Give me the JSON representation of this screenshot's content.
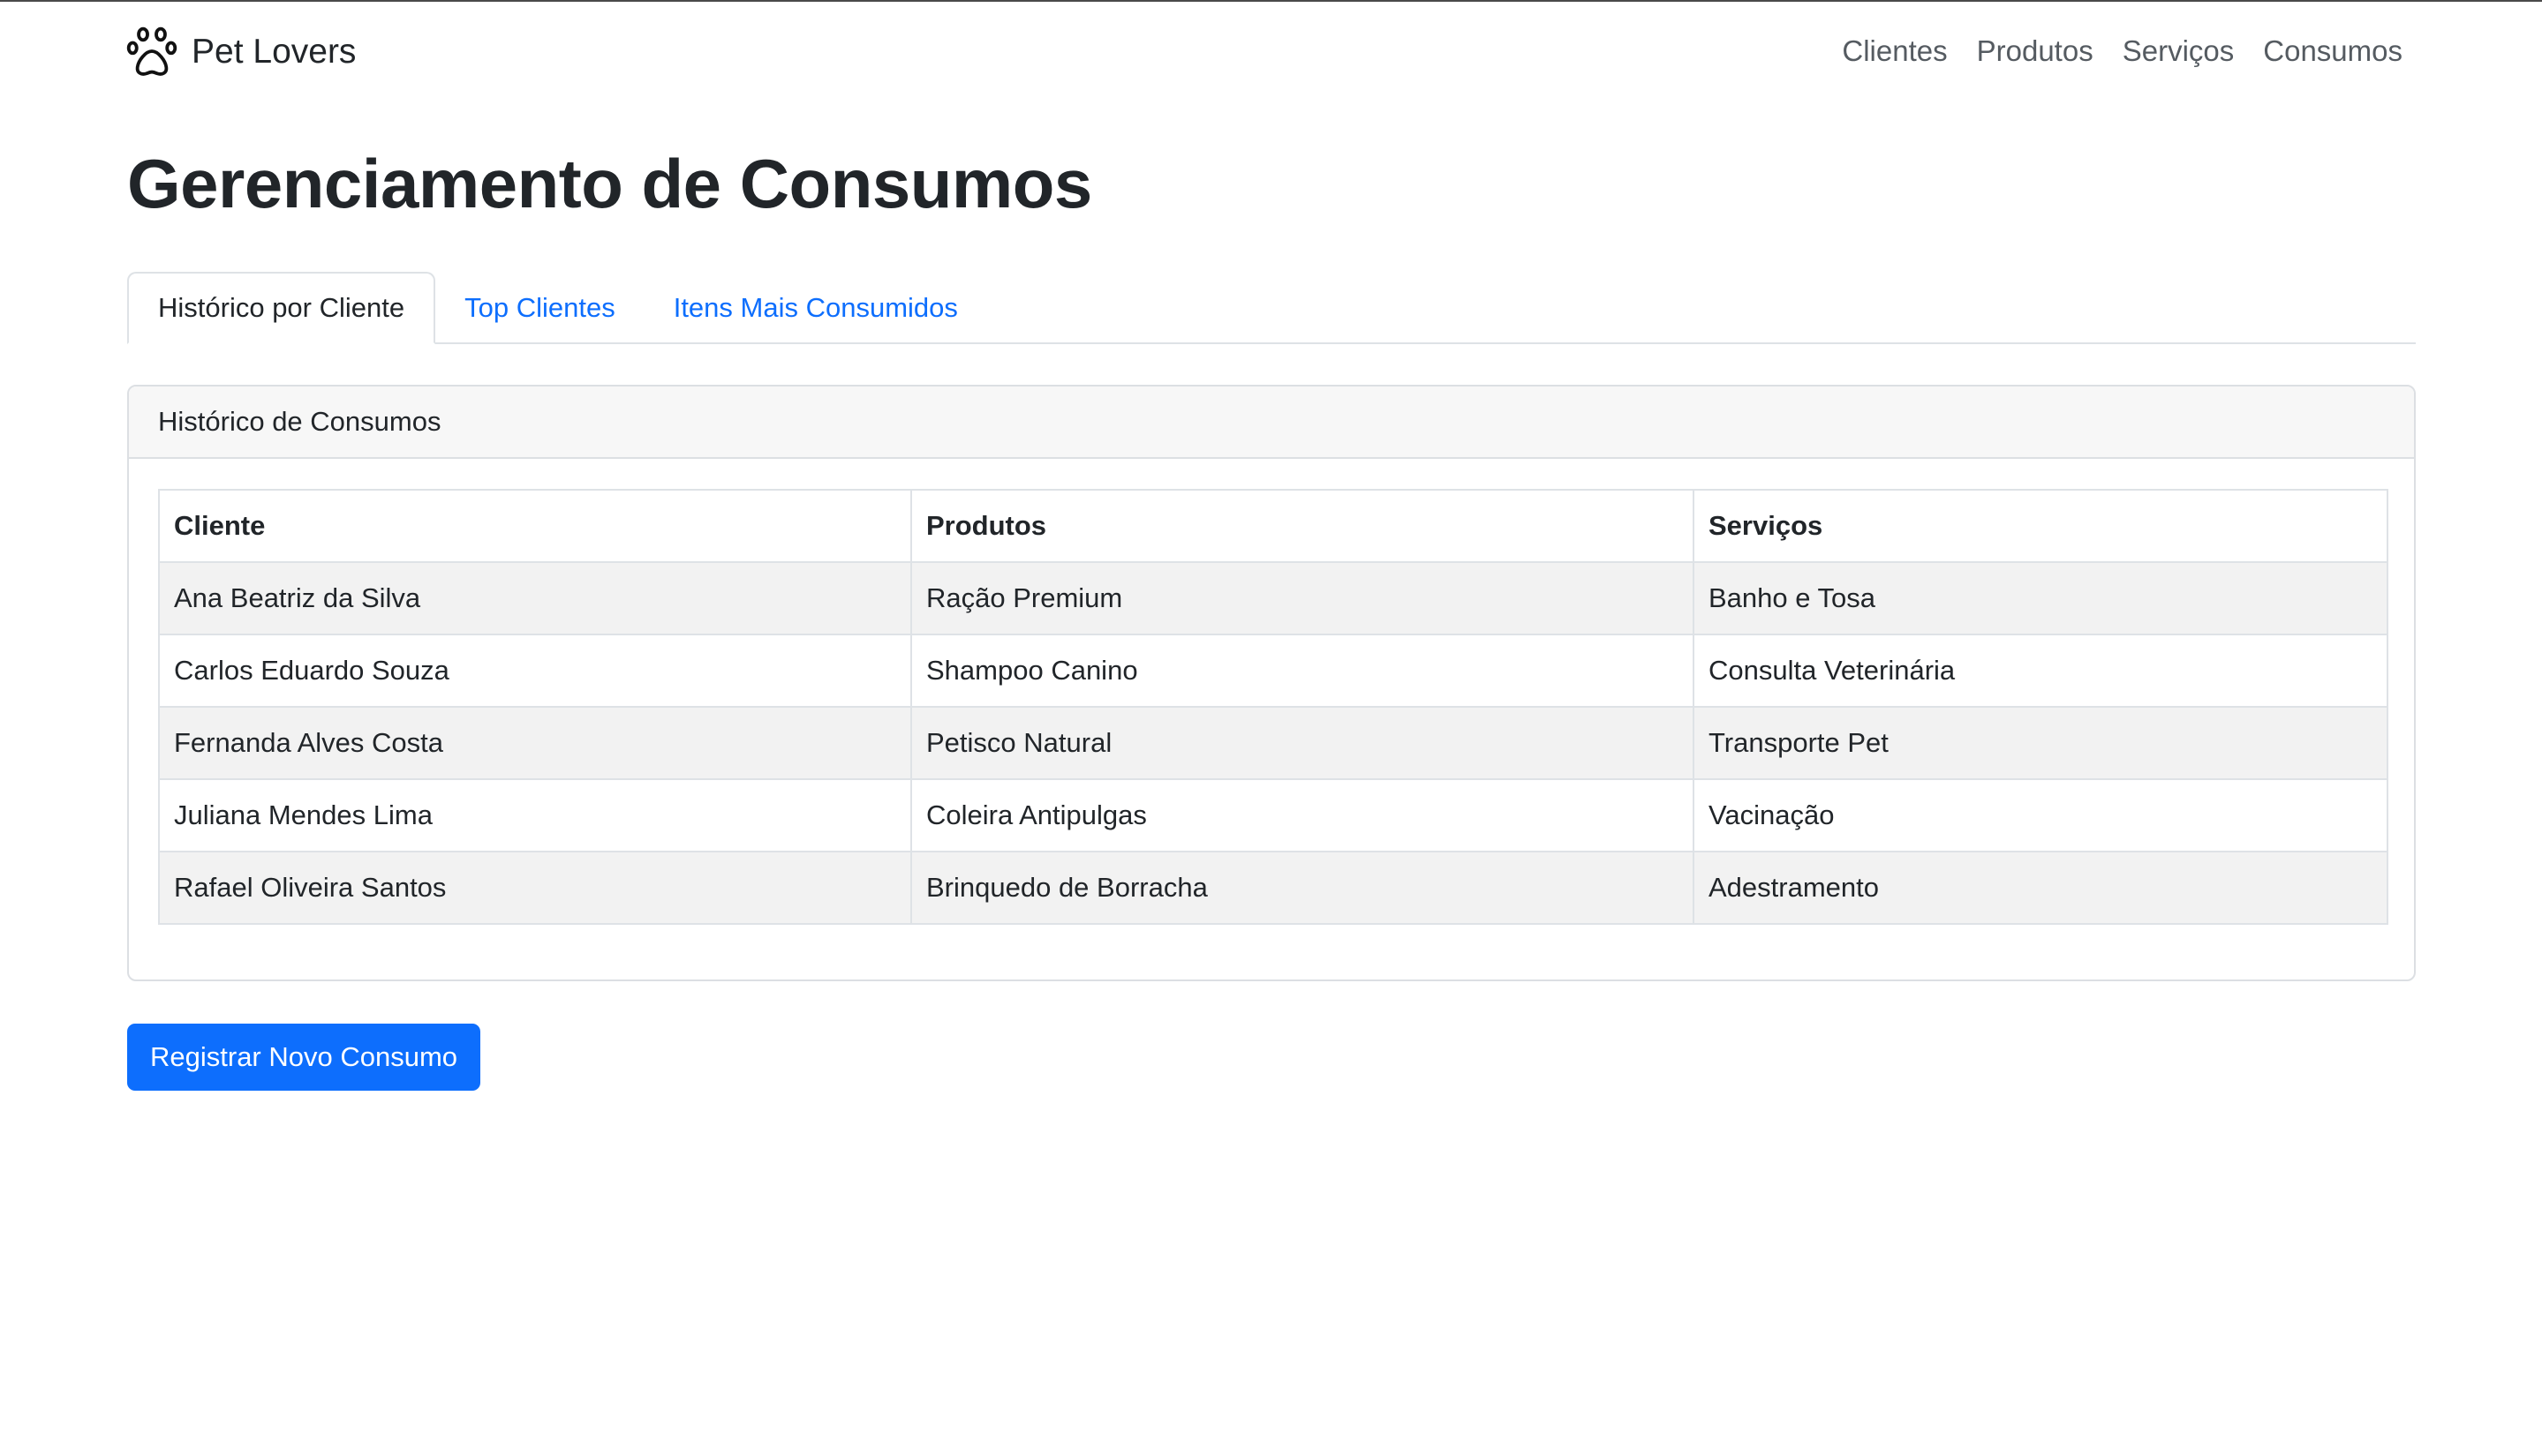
{
  "navbar": {
    "brand": "Pet Lovers",
    "brand_icon": "paw-icon",
    "links": [
      "Clientes",
      "Produtos",
      "Serviços",
      "Consumos"
    ]
  },
  "page": {
    "title": "Gerenciamento de Consumos"
  },
  "tabs": [
    {
      "label": "Histórico por Cliente",
      "active": true
    },
    {
      "label": "Top Clientes",
      "active": false
    },
    {
      "label": "Itens Mais Consumidos",
      "active": false
    }
  ],
  "card": {
    "header": "Histórico de Consumos",
    "table": {
      "columns": [
        "Cliente",
        "Produtos",
        "Serviços"
      ],
      "rows": [
        [
          "Ana Beatriz da Silva",
          "Ração Premium",
          "Banho e Tosa"
        ],
        [
          "Carlos Eduardo Souza",
          "Shampoo Canino",
          "Consulta Veterinária"
        ],
        [
          "Fernanda Alves Costa",
          "Petisco Natural",
          "Transporte Pet"
        ],
        [
          "Juliana Mendes Lima",
          "Coleira Antipulgas",
          "Vacinação"
        ],
        [
          "Rafael Oliveira Santos",
          "Brinquedo de Borracha",
          "Adestramento"
        ]
      ]
    }
  },
  "actions": {
    "register_label": "Registrar Novo Consumo"
  },
  "colors": {
    "primary": "#0d6efd",
    "text": "#212529",
    "nav_link": "#555b61",
    "striped_row": "#f2f2f2",
    "border": "#dee2e6"
  }
}
